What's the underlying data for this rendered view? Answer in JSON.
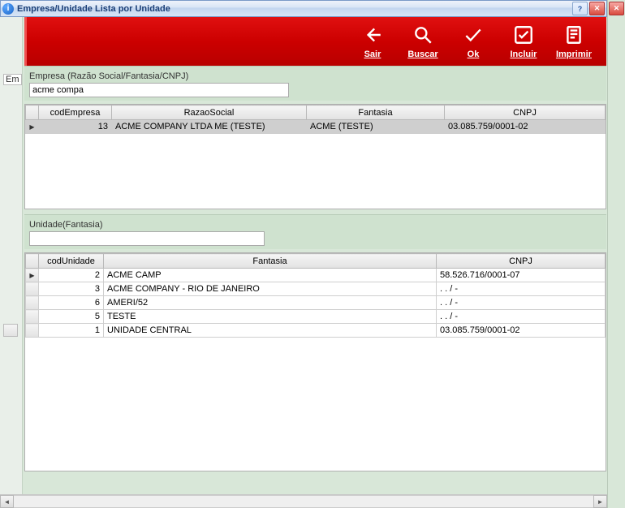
{
  "window": {
    "title": "Empresa/Unidade  Lista por Unidade"
  },
  "left_tab": "Em",
  "toolbar": {
    "sair": {
      "label": "Sair",
      "accel_index": 0
    },
    "buscar": {
      "label": "Buscar",
      "accel_index": 0
    },
    "ok": {
      "label": "Ok",
      "accel_index": 0
    },
    "incluir": {
      "label": "Incluir",
      "accel_index": 0
    },
    "imprimir": {
      "label": "Imprimir",
      "accel_index": 0
    }
  },
  "empresa_search": {
    "label": "Empresa (Razão Social/Fantasia/CNPJ)",
    "value": "acme compa"
  },
  "unidade_search": {
    "label": "Unidade(Fantasia)",
    "value": ""
  },
  "grid1": {
    "columns": [
      "codEmpresa",
      "RazaoSocial",
      "Fantasia",
      "CNPJ"
    ],
    "rows": [
      {
        "selected": true,
        "codEmpresa": "13",
        "RazaoSocial": "ACME COMPANY LTDA ME (TESTE)",
        "Fantasia": "ACME (TESTE)",
        "CNPJ": "03.085.759/0001-02"
      }
    ]
  },
  "grid2": {
    "columns": [
      "codUnidade",
      "Fantasia",
      "CNPJ"
    ],
    "rows": [
      {
        "selected": true,
        "codUnidade": "2",
        "Fantasia": "ACME CAMP",
        "CNPJ": "58.526.716/0001-07"
      },
      {
        "selected": false,
        "codUnidade": "3",
        "Fantasia": "ACME COMPANY - RIO DE JANEIRO",
        "CNPJ": "  .   .   /    -"
      },
      {
        "selected": false,
        "codUnidade": "6",
        "Fantasia": "AMERI/52",
        "CNPJ": "  .   .   /    -"
      },
      {
        "selected": false,
        "codUnidade": "5",
        "Fantasia": "TESTE",
        "CNPJ": "  .   .   /    -"
      },
      {
        "selected": false,
        "codUnidade": "1",
        "Fantasia": "UNIDADE CENTRAL",
        "CNPJ": "03.085.759/0001-02"
      }
    ]
  }
}
